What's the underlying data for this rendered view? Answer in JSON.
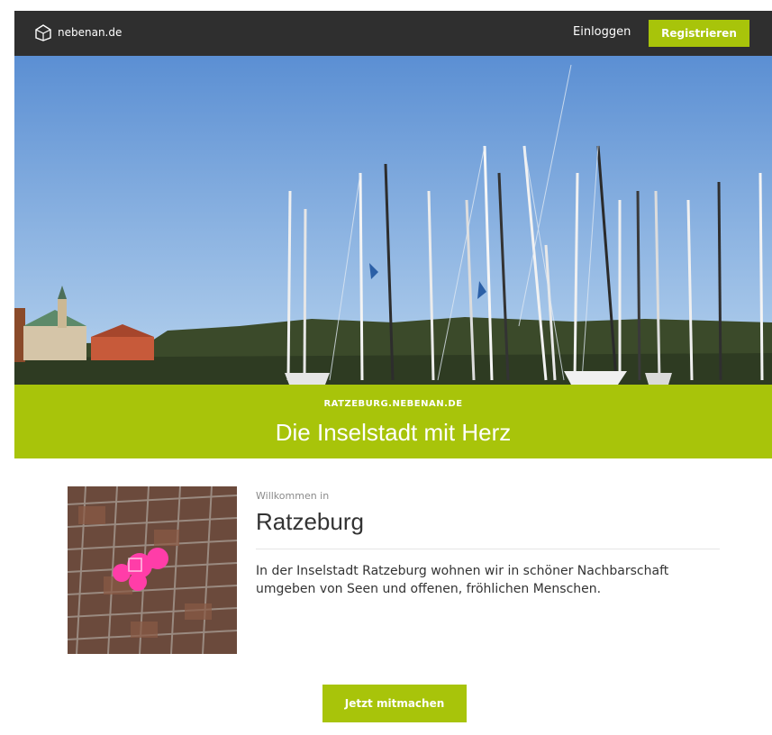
{
  "navbar": {
    "brand_name": "nebenan.de",
    "login_label": "Einloggen",
    "register_label": "Registrieren"
  },
  "hero": {
    "image_subject": "harbour-sailboat-masts"
  },
  "band": {
    "subtitle": "RATZEBURG.NEBENAN.DE",
    "title": "Die Inselstadt mit Herz"
  },
  "content": {
    "welcome_label": "Willkommen in",
    "city_name": "Ratzeburg",
    "description": "In der Inselstadt Ratzeburg wohnen wir in schöner Nachbarschaft umgeben von Seen und offenen, fröhlichen Menschen.",
    "join_label": "Jetzt mitmachen"
  },
  "colors": {
    "accent": "#a8c40a",
    "navbar": "#2f2f2f"
  }
}
